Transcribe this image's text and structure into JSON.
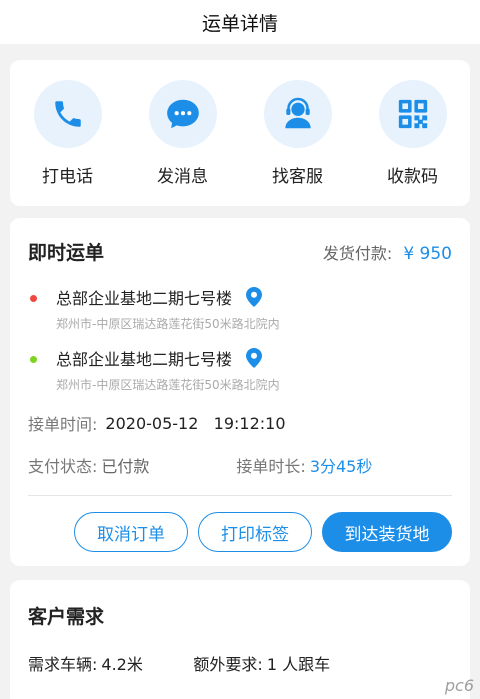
{
  "header": {
    "title": "运单详情"
  },
  "actions": [
    {
      "label": "打电话",
      "icon": "phone-icon"
    },
    {
      "label": "发消息",
      "icon": "chat-icon"
    },
    {
      "label": "找客服",
      "icon": "customer-service-icon"
    },
    {
      "label": "收款码",
      "icon": "qr-code-icon"
    }
  ],
  "order": {
    "title": "即时运单",
    "pay_label": "发货付款:",
    "pay_amount": "¥ 950",
    "from": {
      "name": "总部企业基地二期七号楼",
      "detail": "郑州市-中原区瑞达路莲花街50米路北院内",
      "dot_color": "#f0483e"
    },
    "to": {
      "name": "总部企业基地二期七号楼",
      "detail": "郑州市-中原区瑞达路莲花街50米路北院内",
      "dot_color": "#7ed321"
    },
    "accept_time_label": "接单时间:",
    "accept_time_value": "2020-05-12   19:12:10",
    "pay_status_label": "支付状态:",
    "pay_status_value": "已付款",
    "duration_label": "接单时长:",
    "duration_value": "3分45秒",
    "buttons": {
      "cancel": "取消订单",
      "print": "打印标签",
      "arrive": "到达装货地"
    }
  },
  "requirements": {
    "title": "客户需求",
    "vehicle_label": "需求车辆:",
    "vehicle_value": "4.2米",
    "extra_label": "额外要求:",
    "extra_value": "1 人跟车"
  },
  "watermark": "pc6",
  "colors": {
    "accent": "#1d8ee8",
    "icon_bg": "#e7f2fd"
  }
}
